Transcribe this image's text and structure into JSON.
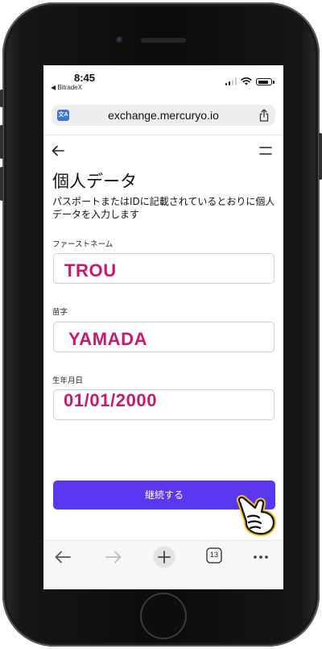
{
  "status_bar": {
    "time": "8:45",
    "back_app": "◀ BitradeX",
    "signal_bars": 2
  },
  "browser": {
    "url": "exchange.mercuryo.io",
    "translate_glyph": "文A",
    "tab_count": "13"
  },
  "page": {
    "title": "個人データ",
    "description": "パスポートまたはIDに記載されているとおりに個人データを入力します",
    "fields": [
      {
        "label": "ファーストネーム",
        "value": "TROU"
      },
      {
        "label": "苗字",
        "value": "YAMADA"
      },
      {
        "label": "生年月日",
        "value": "01/01/2000"
      }
    ],
    "continue_label": "継続する"
  },
  "colors": {
    "accent": "#5a37f0",
    "annotation_text": "#c8196e",
    "translate_icon": "#3c74d9"
  },
  "icons": {
    "toolbar": [
      "back-icon",
      "forward-icon",
      "new-tab-icon",
      "tabs-icon",
      "more-icon"
    ]
  }
}
